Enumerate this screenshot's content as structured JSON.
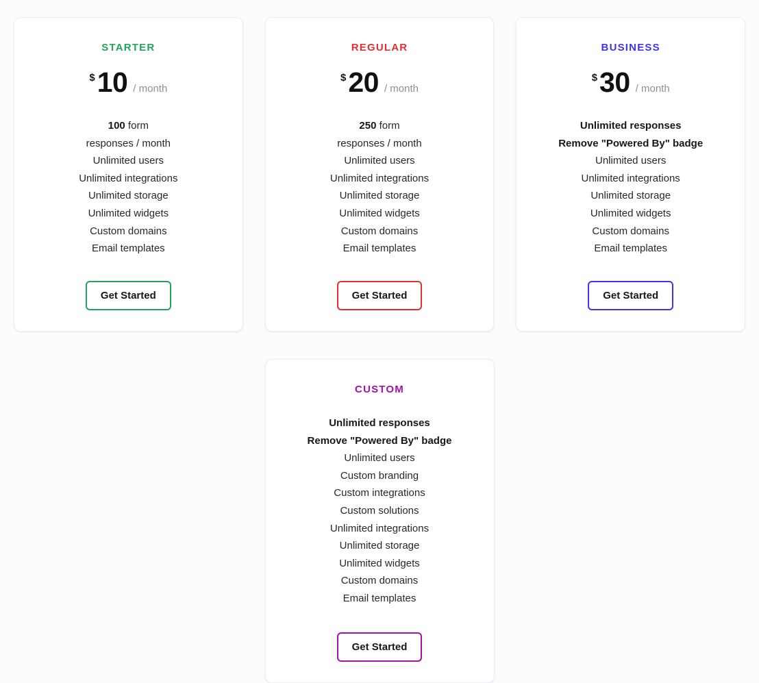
{
  "page": {
    "background_color": "#fcfcfe",
    "card_background_color": "#ffffff",
    "card_border_color": "#eceef1"
  },
  "plans": [
    {
      "id": "starter",
      "name": "STARTER",
      "accent_color": "#22a35c",
      "currency": "$",
      "amount": "10",
      "period": "/ month",
      "has_price": true,
      "features": [
        {
          "lead": "100",
          "text": " form",
          "strong": false
        },
        {
          "lead": "",
          "text": "responses / month",
          "strong": false
        },
        {
          "lead": "",
          "text": "Unlimited users",
          "strong": false
        },
        {
          "lead": "",
          "text": "Unlimited integrations",
          "strong": false
        },
        {
          "lead": "",
          "text": "Unlimited storage",
          "strong": false
        },
        {
          "lead": "",
          "text": "Unlimited widgets",
          "strong": false
        },
        {
          "lead": "",
          "text": "Custom domains",
          "strong": false
        },
        {
          "lead": "",
          "text": "Email templates",
          "strong": false
        }
      ],
      "cta_label": "Get Started"
    },
    {
      "id": "regular",
      "name": "REGULAR",
      "accent_color": "#dc3130",
      "currency": "$",
      "amount": "20",
      "period": "/ month",
      "has_price": true,
      "features": [
        {
          "lead": "250",
          "text": " form",
          "strong": false
        },
        {
          "lead": "",
          "text": "responses / month",
          "strong": false
        },
        {
          "lead": "",
          "text": "Unlimited users",
          "strong": false
        },
        {
          "lead": "",
          "text": "Unlimited integrations",
          "strong": false
        },
        {
          "lead": "",
          "text": "Unlimited storage",
          "strong": false
        },
        {
          "lead": "",
          "text": "Unlimited widgets",
          "strong": false
        },
        {
          "lead": "",
          "text": "Custom domains",
          "strong": false
        },
        {
          "lead": "",
          "text": "Email templates",
          "strong": false
        }
      ],
      "cta_label": "Get Started"
    },
    {
      "id": "business",
      "name": "BUSINESS",
      "accent_color": "#4033e8",
      "currency": "$",
      "amount": "30",
      "period": "/ month",
      "has_price": true,
      "features": [
        {
          "lead": "",
          "text": "Unlimited responses",
          "strong": true
        },
        {
          "lead": "",
          "text": "Remove \"Powered By\" badge",
          "strong": true
        },
        {
          "lead": "",
          "text": "Unlimited users",
          "strong": false
        },
        {
          "lead": "",
          "text": "Unlimited integrations",
          "strong": false
        },
        {
          "lead": "",
          "text": "Unlimited storage",
          "strong": false
        },
        {
          "lead": "",
          "text": "Unlimited widgets",
          "strong": false
        },
        {
          "lead": "",
          "text": "Custom domains",
          "strong": false
        },
        {
          "lead": "",
          "text": "Email templates",
          "strong": false
        }
      ],
      "cta_label": "Get Started"
    },
    {
      "id": "custom",
      "name": "CUSTOM",
      "accent_color": "#a211a8",
      "currency": "",
      "amount": "",
      "period": "",
      "has_price": false,
      "features": [
        {
          "lead": "",
          "text": "Unlimited responses",
          "strong": true
        },
        {
          "lead": "",
          "text": "Remove \"Powered By\" badge",
          "strong": true
        },
        {
          "lead": "",
          "text": "Unlimited users",
          "strong": false
        },
        {
          "lead": "",
          "text": "Custom branding",
          "strong": false
        },
        {
          "lead": "",
          "text": "Custom integrations",
          "strong": false
        },
        {
          "lead": "",
          "text": "Custom solutions",
          "strong": false
        },
        {
          "lead": "",
          "text": "Unlimited integrations",
          "strong": false
        },
        {
          "lead": "",
          "text": "Unlimited storage",
          "strong": false
        },
        {
          "lead": "",
          "text": "Unlimited widgets",
          "strong": false
        },
        {
          "lead": "",
          "text": "Custom domains",
          "strong": false
        },
        {
          "lead": "",
          "text": "Email templates",
          "strong": false
        }
      ],
      "cta_label": "Get Started"
    }
  ]
}
